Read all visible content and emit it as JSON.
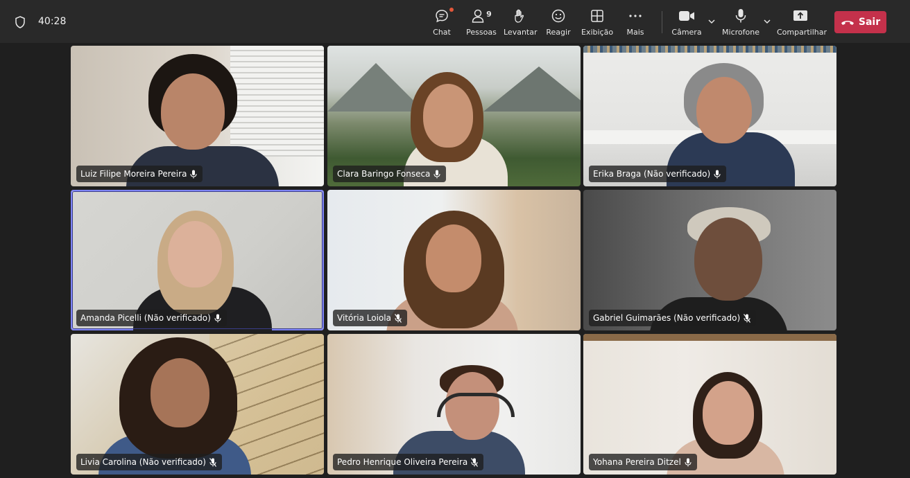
{
  "timer": "40:28",
  "toolbar": {
    "chat": "Chat",
    "people": "Pessoas",
    "people_count": "9",
    "raise": "Levantar",
    "react": "Reagir",
    "view": "Exibição",
    "more": "Mais",
    "camera": "Câmera",
    "mic": "Microfone",
    "share": "Compartilhar",
    "leave": "Sair"
  },
  "participants": [
    {
      "name": "Luiz Filipe Moreira Pereira",
      "muted": false
    },
    {
      "name": "Clara Baringo Fonseca",
      "muted": false
    },
    {
      "name": "Erika Braga (Não verificado)",
      "muted": false
    },
    {
      "name": "Amanda Picelli (Não verificado)",
      "muted": false,
      "active": true
    },
    {
      "name": "Vitória Loiola",
      "muted": true
    },
    {
      "name": "Gabriel Guimarães (Não verificado)",
      "muted": true
    },
    {
      "name": "Livia Carolina (Não verificado)",
      "muted": true
    },
    {
      "name": "Pedro Henrique Oliveira Pereira",
      "muted": true
    },
    {
      "name": "Yohana Pereira Ditzel",
      "muted": false
    }
  ],
  "colors": {
    "leave": "#c4314b",
    "active_outline": "#7f85f5"
  }
}
